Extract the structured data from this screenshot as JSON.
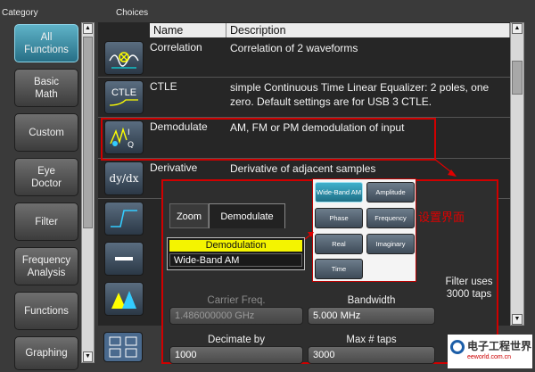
{
  "categories": {
    "header": "Category",
    "items": [
      {
        "label": "All\nFunctions"
      },
      {
        "label": "Basic\nMath"
      },
      {
        "label": "Custom"
      },
      {
        "label": "Eye\nDoctor"
      },
      {
        "label": "Filter"
      },
      {
        "label": "Frequency\nAnalysis"
      },
      {
        "label": "Functions"
      },
      {
        "label": "Graphing"
      }
    ]
  },
  "choices": {
    "header": "Choices",
    "col_name": "Name",
    "col_description": "Description",
    "rows": [
      {
        "name": "Correlation",
        "description": "Correlation of 2 waveforms",
        "icon_label": ""
      },
      {
        "name": "CTLE",
        "description": "simple Continuous Time Linear Equalizer: 2 poles, one zero. Default settings are for USB 3 CTLE.",
        "icon_label": "CTLE"
      },
      {
        "name": "Demodulate",
        "description": "AM, FM or PM demodulation of input",
        "icon_label": ""
      },
      {
        "name": "Derivative",
        "description": "Derivative of adjacent samples",
        "icon_label": "dy/dx"
      }
    ]
  },
  "dialog": {
    "tab_zoom": "Zoom",
    "tab_demodulate": "Demodulate",
    "demod_title": "Demodulation",
    "demod_value": "Wide-Band AM",
    "carrier_label": "Carrier Freq.",
    "carrier_value": "1.486000000 GHz",
    "bandwidth_label": "Bandwidth",
    "bandwidth_value": "5.000 MHz",
    "filter_text": "Filter uses\n3000 taps",
    "decimate_label": "Decimate by",
    "decimate_value": "1000",
    "maxtaps_label": "Max # taps",
    "maxtaps_value": "3000"
  },
  "popup": {
    "options": [
      "Wide-Band AM",
      "Amplitude",
      "Phase",
      "Frequency",
      "Real",
      "Imaginary",
      "Time"
    ]
  },
  "annotation": "设置界面",
  "logo": {
    "line1": "电子工程世界",
    "line2": "eeworld.com.cn"
  }
}
